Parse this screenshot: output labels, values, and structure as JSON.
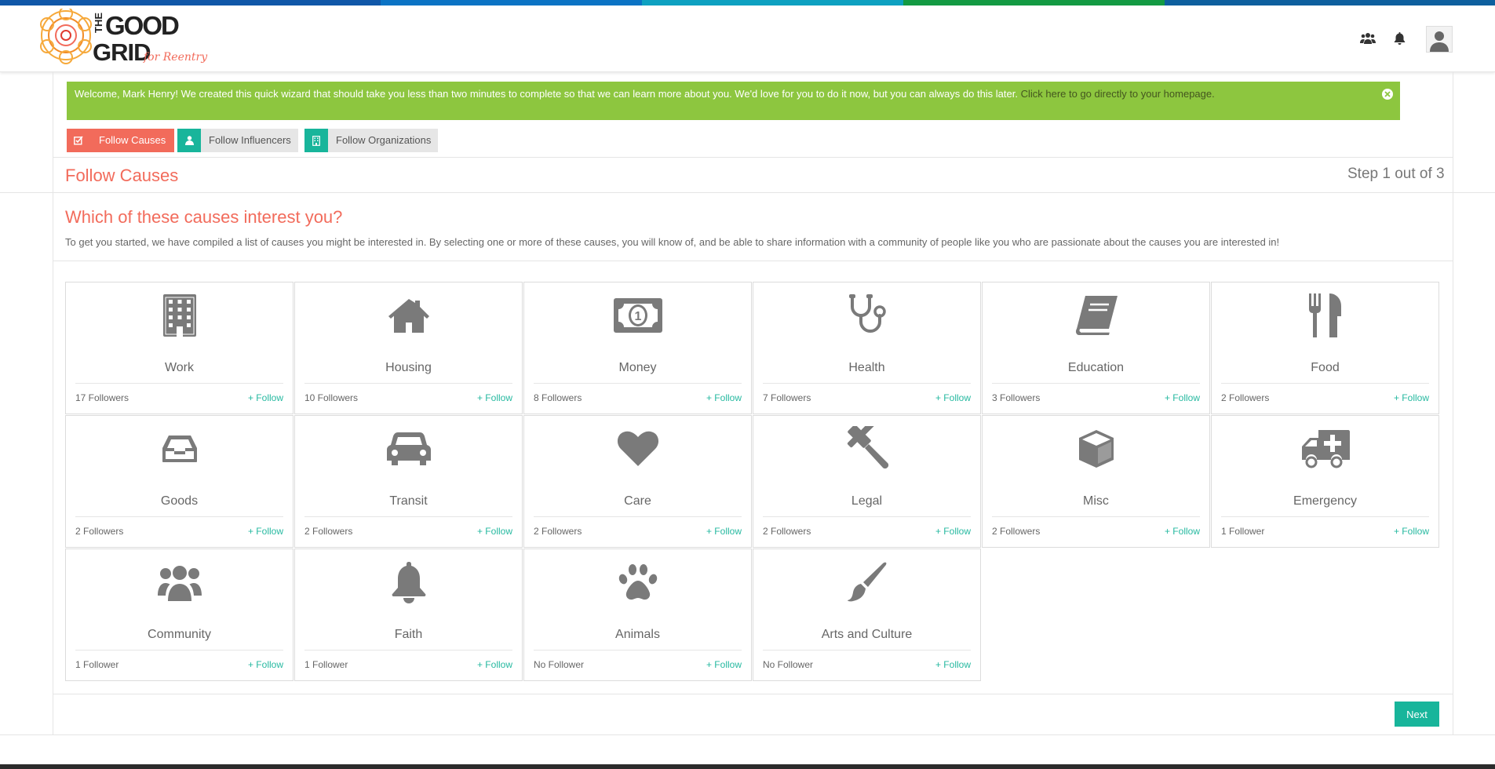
{
  "colors": {
    "strip": [
      "#1057a8",
      "#0b73c4",
      "#0ea1c1",
      "#139a43",
      "#0d5f9e"
    ],
    "accent_red": "#f26b5b",
    "accent_teal": "#18b59b",
    "banner_green": "#8dc63f",
    "icon_gray": "#7a7a7a"
  },
  "header": {
    "logo_text_line1": "THE",
    "logo_text_line2": "GOOD",
    "logo_text_line3": "GRID",
    "logo_tagline": "for Reentry",
    "icons": [
      "users-icon",
      "bell-icon",
      "avatar-icon"
    ]
  },
  "welcome": {
    "message": "Welcome, Mark Henry! We created this quick wizard that should take you less than two minutes to complete so that we can learn more about you. We'd love for you to do it now, but you can always do this later. ",
    "link_text": "Click here to go directly to your homepage."
  },
  "wizard_tabs": [
    {
      "label": "Follow Causes",
      "icon": "check-square-icon",
      "active": true
    },
    {
      "label": "Follow Influencers",
      "icon": "user-icon",
      "active": false
    },
    {
      "label": "Follow Organizations",
      "icon": "building-icon",
      "active": false
    }
  ],
  "section": {
    "title": "Follow Causes",
    "step": "Step 1 out of 3"
  },
  "question": {
    "title": "Which of these causes interest you?",
    "description": "To get you started, we have compiled a list of causes you might be interested in. By selecting one or more of these causes, you will know of, and be able to share information with a community of people like you who are passionate about the causes you are interested in!"
  },
  "causes": [
    {
      "name": "Work",
      "followers": "17 Followers",
      "follow": "+ Follow",
      "icon": "office-building-icon"
    },
    {
      "name": "Housing",
      "followers": "10 Followers",
      "follow": "+ Follow",
      "icon": "house-icon"
    },
    {
      "name": "Money",
      "followers": "8 Followers",
      "follow": "+ Follow",
      "icon": "banknote-icon"
    },
    {
      "name": "Health",
      "followers": "7 Followers",
      "follow": "+ Follow",
      "icon": "stethoscope-icon"
    },
    {
      "name": "Education",
      "followers": "3 Followers",
      "follow": "+ Follow",
      "icon": "book-icon"
    },
    {
      "name": "Food",
      "followers": "2 Followers",
      "follow": "+ Follow",
      "icon": "fork-knife-icon"
    },
    {
      "name": "Goods",
      "followers": "2 Followers",
      "follow": "+ Follow",
      "icon": "inbox-tray-icon"
    },
    {
      "name": "Transit",
      "followers": "2 Followers",
      "follow": "+ Follow",
      "icon": "car-icon"
    },
    {
      "name": "Care",
      "followers": "2 Followers",
      "follow": "+ Follow",
      "icon": "heart-icon"
    },
    {
      "name": "Legal",
      "followers": "2 Followers",
      "follow": "+ Follow",
      "icon": "gavel-icon"
    },
    {
      "name": "Misc",
      "followers": "2 Followers",
      "follow": "+ Follow",
      "icon": "cube-icon"
    },
    {
      "name": "Emergency",
      "followers": "1 Follower",
      "follow": "+ Follow",
      "icon": "ambulance-icon"
    },
    {
      "name": "Community",
      "followers": "1 Follower",
      "follow": "+ Follow",
      "icon": "group-icon"
    },
    {
      "name": "Faith",
      "followers": "1 Follower",
      "follow": "+ Follow",
      "icon": "church-bell-icon"
    },
    {
      "name": "Animals",
      "followers": "No Follower",
      "follow": "+ Follow",
      "icon": "paw-icon"
    },
    {
      "name": "Arts and Culture",
      "followers": "No Follower",
      "follow": "+ Follow",
      "icon": "paintbrush-icon"
    }
  ],
  "footer_actions": {
    "next_label": "Next"
  }
}
